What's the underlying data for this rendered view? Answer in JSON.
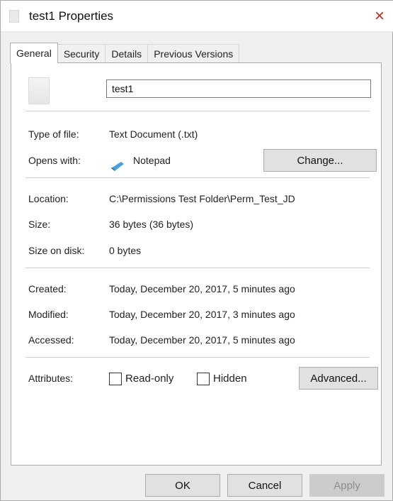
{
  "window": {
    "title": "test1 Properties",
    "close_glyph": "×"
  },
  "tabs": [
    {
      "label": "General",
      "active": true
    },
    {
      "label": "Security",
      "active": false
    },
    {
      "label": "Details",
      "active": false
    },
    {
      "label": "Previous Versions",
      "active": false
    }
  ],
  "general": {
    "file_name": "test1",
    "type_label": "Type of file:",
    "type_value": "Text Document (.txt)",
    "opens_label": "Opens with:",
    "opens_value": "Notepad",
    "change_label": "Change...",
    "location_label": "Location:",
    "location_value": "C:\\Permissions Test Folder\\Perm_Test_JD",
    "size_label": "Size:",
    "size_value": "36 bytes (36 bytes)",
    "size_disk_label": "Size on disk:",
    "size_disk_value": "0 bytes",
    "created_label": "Created:",
    "created_value": "Today, December 20, 2017, 5 minutes ago",
    "modified_label": "Modified:",
    "modified_value": "Today, December 20, 2017, 3 minutes ago",
    "accessed_label": "Accessed:",
    "accessed_value": "Today, December 20, 2017, 5 minutes ago",
    "attributes_label": "Attributes:",
    "readonly_label": "Read-only",
    "readonly_checked": false,
    "hidden_label": "Hidden",
    "hidden_checked": false,
    "advanced_label": "Advanced..."
  },
  "buttons": {
    "ok": "OK",
    "cancel": "Cancel",
    "apply": "Apply"
  },
  "icons": {
    "file": "text-file-icon",
    "notepad": "notepad-icon",
    "close": "close-icon"
  },
  "colors": {
    "close": "#c42b1c",
    "panel": "#ffffff",
    "window": "#f0f0f0"
  }
}
